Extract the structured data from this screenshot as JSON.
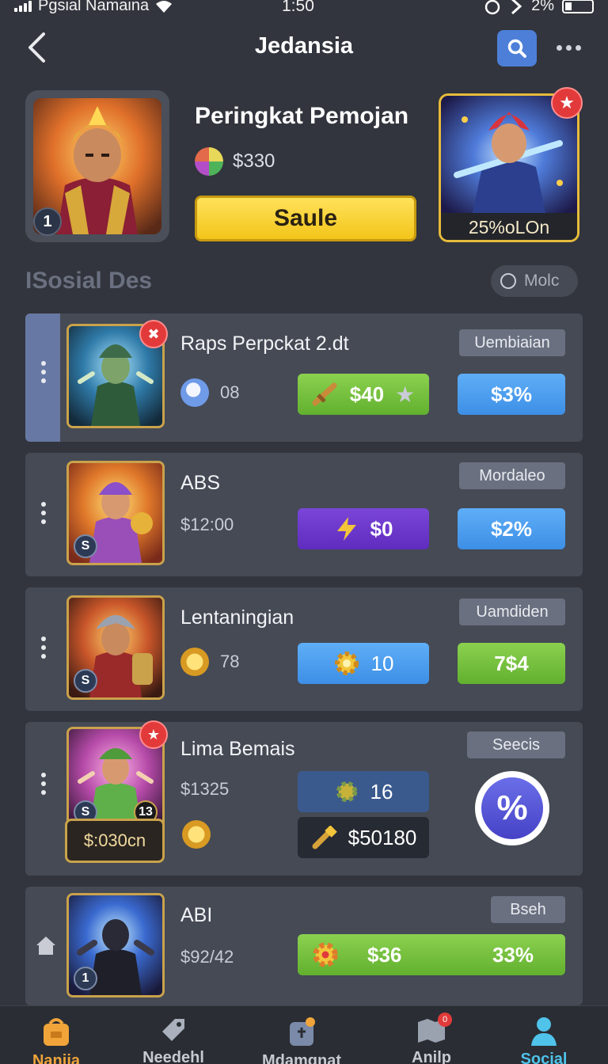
{
  "status_bar": {
    "carrier": "Pgsial Namaina",
    "time": "1:50",
    "battery": "2%"
  },
  "header": {
    "title": "Jedansia"
  },
  "hero": {
    "rank": "1",
    "title": "Peringkat Pemojan",
    "price": "$330",
    "sale_label": "Saule",
    "promo_label": "25%oLOn"
  },
  "section": {
    "title": "ISosial Des",
    "filter_label": "Molc"
  },
  "rows": [
    {
      "name": "Raps Perpckat 2.dt",
      "stat": "08",
      "tag": "Uembiaian",
      "primary_value": "$40",
      "secondary_value": "$3%"
    },
    {
      "name": "ABS",
      "level": "S",
      "stat": "$12:00",
      "tag": "Mordaleo",
      "primary_value": "$0",
      "secondary_value": "$2%"
    },
    {
      "name": "Lentaningian",
      "level": "S",
      "stat": "78",
      "tag": "Uamdiden",
      "primary_value": "10",
      "secondary_value": "7$4"
    },
    {
      "name": "Lima Bemais",
      "level": "S",
      "badge": "13",
      "stat": "$1325",
      "price_plate": "$:030cn",
      "tag": "Seecis",
      "primary_value": "16",
      "secondary_value": "$50180",
      "percent_symbol": "%"
    },
    {
      "name": "ABI",
      "level": "1",
      "stat": "$92/42",
      "tag": "Bseh",
      "primary_value": "$36",
      "secondary_value": "33%"
    }
  ],
  "nav": [
    {
      "label": "Nanjia",
      "icon": "backpack-icon"
    },
    {
      "label": "Needehl",
      "icon": "tag-icon"
    },
    {
      "label": "Mdamgnat",
      "icon": "shield-icon"
    },
    {
      "label": "Anilp",
      "icon": "map-icon",
      "badge": "0"
    },
    {
      "label": "Social",
      "icon": "person-icon"
    }
  ],
  "colors": {
    "background": "#32353d",
    "accent_blue": "#4d7fd8",
    "sale_yellow": "#f2c51a",
    "green": "#62b02f",
    "purple": "#5f2cbf"
  }
}
